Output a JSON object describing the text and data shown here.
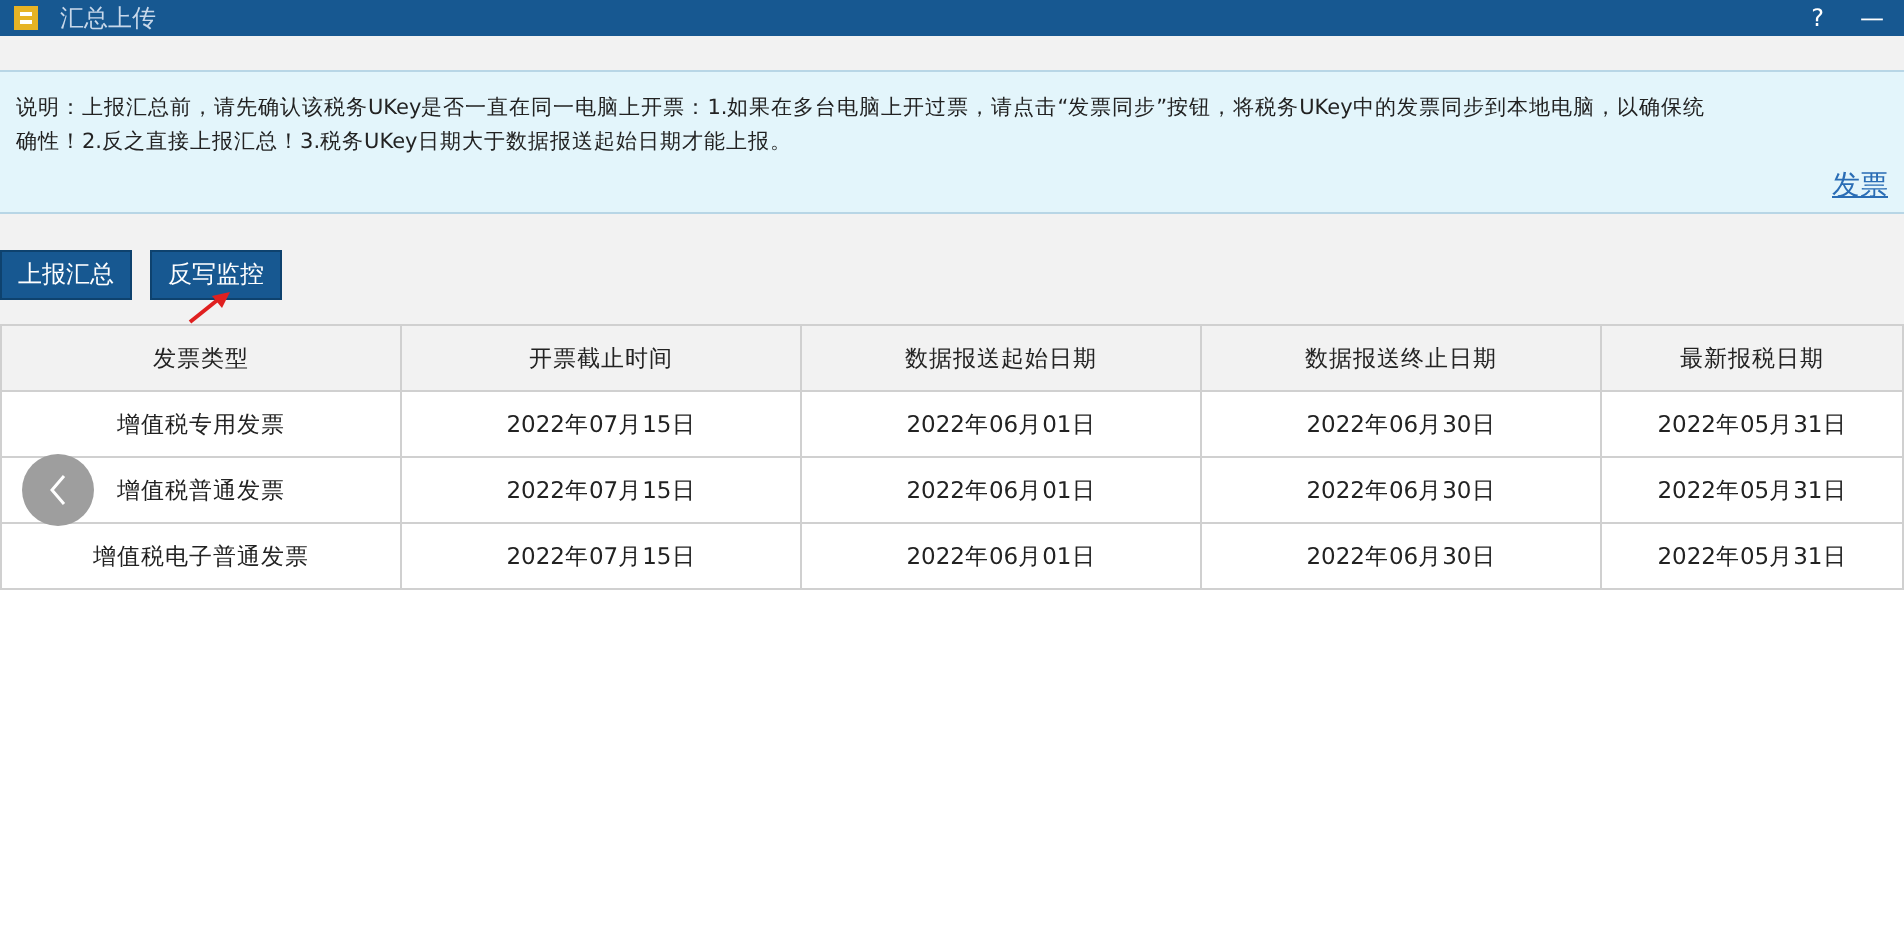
{
  "window": {
    "title": "汇总上传",
    "help": "?",
    "minimize": "—"
  },
  "notice": {
    "lines": [
      "说明：上报汇总前，请先确认该税务UKey是否一直在同一电脑上开票：1.如果在多台电脑上开过票，请点击“发票同步”按钮，将税务UKey中的发票同步到本地电脑，以确保统",
      "确性！2.反之直接上报汇总！3.税务UKey日期大于数据报送起始日期才能上报。"
    ],
    "link": "发票"
  },
  "buttons": [
    "上报汇总",
    "反写监控"
  ],
  "table": {
    "columns": [
      "发票类型",
      "开票截止时间",
      "数据报送起始日期",
      "数据报送终止日期",
      "最新报税日期"
    ],
    "rows": [
      [
        "增值税专用发票",
        "2022年07月15日",
        "2022年06月01日",
        "2022年06月30日",
        "2022年05月31日"
      ],
      [
        "增值税普通发票",
        "2022年07月15日",
        "2022年06月01日",
        "2022年06月30日",
        "2022年05月31日"
      ],
      [
        "增值税电子普通发票",
        "2022年07月15日",
        "2022年06月01日",
        "2022年06月30日",
        "2022年05月31日"
      ]
    ]
  }
}
